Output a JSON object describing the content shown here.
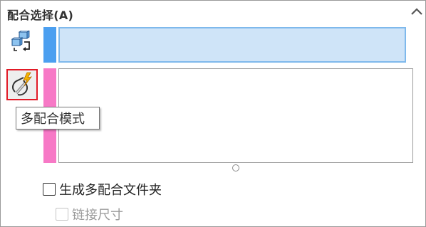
{
  "header": {
    "title": "配合选择(A)",
    "collapse_icon": "chevron-up-icon"
  },
  "icons": {
    "swap": "mate-swap-icon",
    "multi_mate": "multi-mate-mode-icon"
  },
  "tooltip": {
    "text": "多配合模式"
  },
  "options": {
    "create_folder_label": "生成多配合文件夹",
    "create_folder_checked": false,
    "link_dimensions_label": "链接尺寸",
    "link_dimensions_enabled": false
  },
  "colors": {
    "selection_blue": "#4b9ff0",
    "selection_pink": "#f779c6",
    "selection_fill": "#cfe4f8",
    "highlight_border": "#e21a26"
  }
}
